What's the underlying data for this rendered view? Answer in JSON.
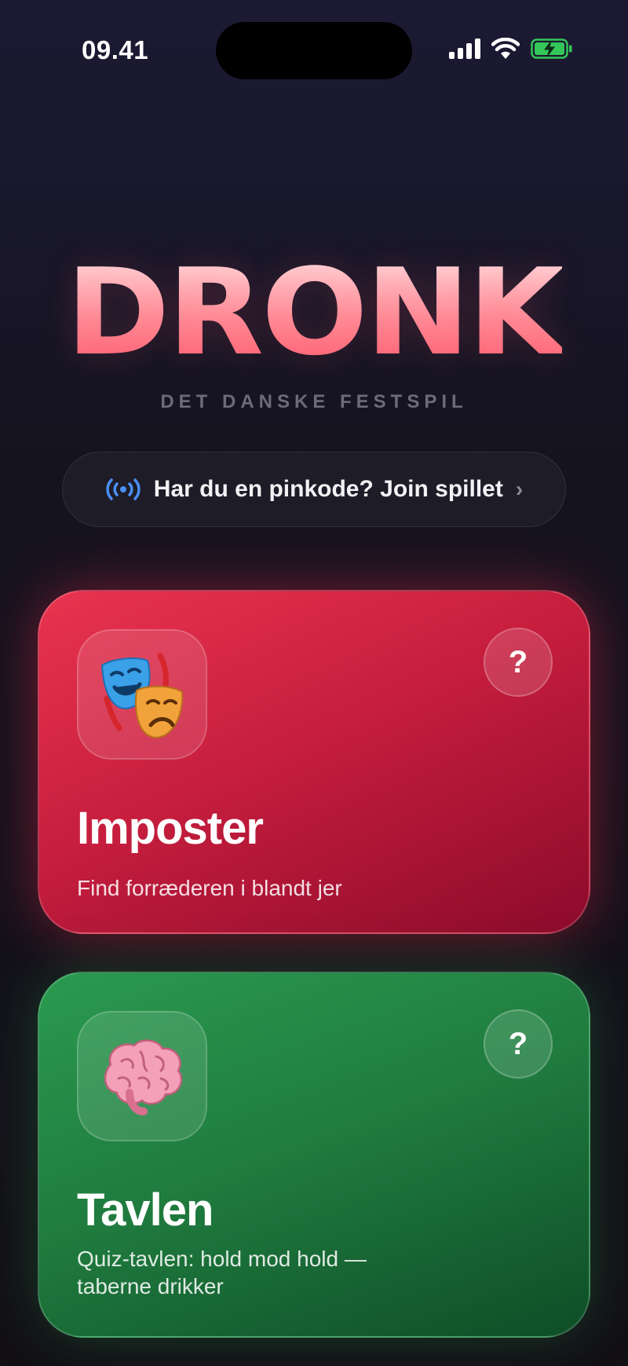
{
  "status_bar": {
    "time": "09.41"
  },
  "header": {
    "title": "DRONK",
    "subtitle": "DET DANSKE FESTSPIL"
  },
  "join": {
    "label": "Har du en pinkode? Join spillet"
  },
  "games": [
    {
      "title": "Imposter",
      "description": "Find forræderen i blandt jer",
      "help_label": "?",
      "icon": "theater-masks-icon",
      "color": "#d42a47"
    },
    {
      "title": "Tavlen",
      "description": "Quiz-tavlen: hold mod hold — taberne drikker",
      "help_label": "?",
      "icon": "brain-icon",
      "color": "#228a46"
    }
  ],
  "colors": {
    "accent": "#ff6b7a",
    "signal": "#4a8ff7",
    "battery": "#34c759"
  }
}
